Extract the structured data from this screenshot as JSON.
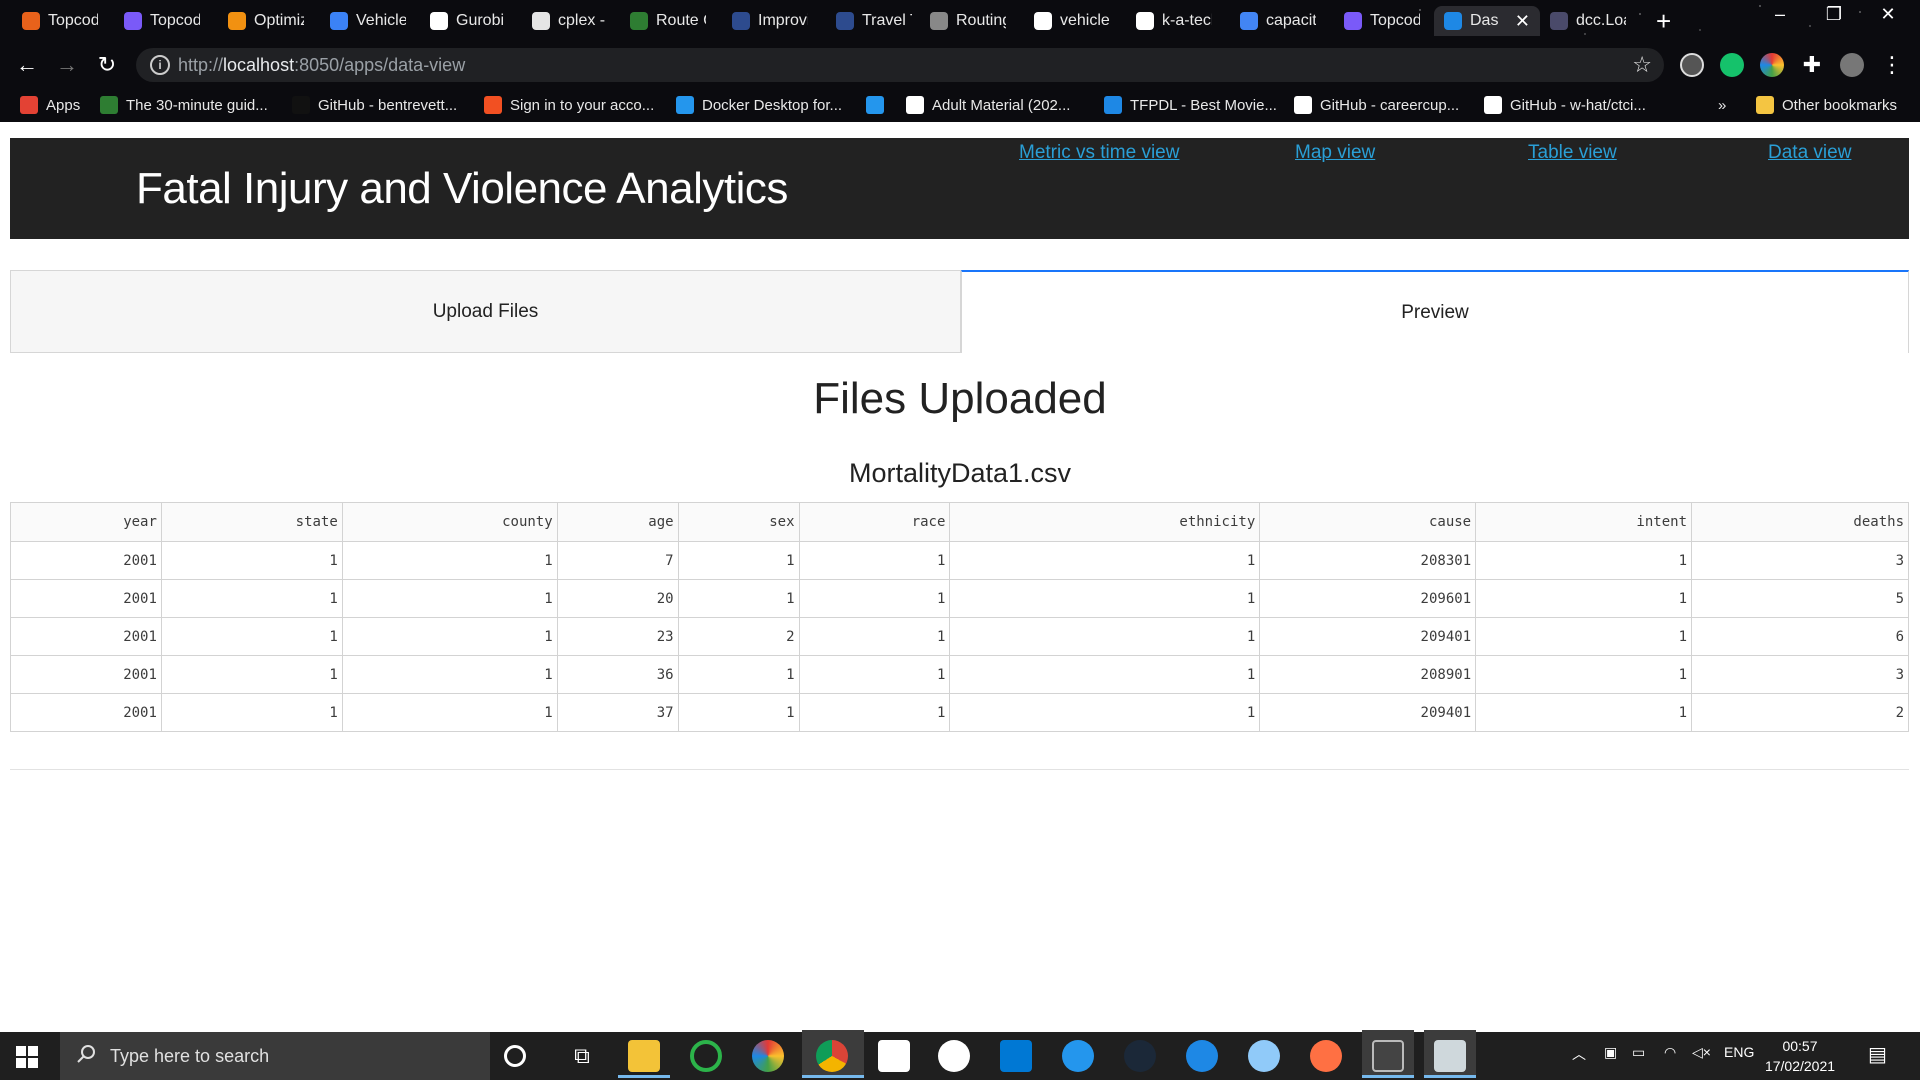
{
  "browser": {
    "tabs": [
      {
        "label": "Topcod",
        "color": "#e8621b"
      },
      {
        "label": "Topcod",
        "color": "#7a5af8"
      },
      {
        "label": "Optimiz",
        "color": "#f29111"
      },
      {
        "label": "Vehicle",
        "color": "#3b82f6"
      },
      {
        "label": "Gurobi",
        "color": "#ffffff"
      },
      {
        "label": "cplex - F",
        "color": "#e5e5e5"
      },
      {
        "label": "Route C",
        "color": "#2e7d32"
      },
      {
        "label": "Improvi",
        "color": "#2d4b8e"
      },
      {
        "label": "Travel T",
        "color": "#2d4b8e"
      },
      {
        "label": "Routing",
        "color": "#888888"
      },
      {
        "label": "vehicle",
        "color": "#ffffff"
      },
      {
        "label": "k-a-tecl",
        "color": "#ffffff"
      },
      {
        "label": "capacit",
        "color": "#4285f4"
      },
      {
        "label": "Topcod",
        "color": "#7a5af8"
      },
      {
        "label": "Das",
        "color": "#1e88e5"
      },
      {
        "label": "dcc.Loa",
        "color": "#4a4a6a"
      }
    ],
    "url_prefix": "http://",
    "url_host": "localhost",
    "url_rest": ":8050/apps/data-view",
    "bookmarks": [
      {
        "label": "Apps",
        "color": "#e34234"
      },
      {
        "label": "The 30-minute guid...",
        "color": "#2e7d32"
      },
      {
        "label": "GitHub - bentrevett...",
        "color": "#111111"
      },
      {
        "label": "Sign in to your acco...",
        "color": "#f25022"
      },
      {
        "label": "Docker Desktop for...",
        "color": "#2496ed"
      },
      {
        "label": "",
        "color": "#2496ed"
      },
      {
        "label": "Adult Material (202...",
        "color": "#ffffff"
      },
      {
        "label": "TFPDL - Best Movie...",
        "color": "#1e88e5"
      },
      {
        "label": "GitHub - careercup...",
        "color": "#ffffff"
      },
      {
        "label": "GitHub - w-hat/ctci...",
        "color": "#ffffff"
      }
    ],
    "bookmarks_overflow": "»",
    "other_bookmarks": "Other bookmarks"
  },
  "header": {
    "title": "Fatal Injury and Violence Analytics",
    "nav": [
      {
        "label": "Metric vs time view"
      },
      {
        "label": "Map view"
      },
      {
        "label": "Table view"
      },
      {
        "label": "Data view"
      }
    ]
  },
  "tabs": {
    "upload_label": "Upload Files",
    "preview_label": "Preview",
    "active": "Preview"
  },
  "content": {
    "title": "Files Uploaded",
    "file_name": "MortalityData1.csv",
    "table": {
      "columns": [
        "year",
        "state",
        "county",
        "age",
        "sex",
        "race",
        "ethnicity",
        "cause",
        "intent",
        "deaths"
      ],
      "rows": [
        [
          "2001",
          "1",
          "1",
          "7",
          "1",
          "1",
          "1",
          "208301",
          "1",
          "3"
        ],
        [
          "2001",
          "1",
          "1",
          "20",
          "1",
          "1",
          "1",
          "209601",
          "1",
          "5"
        ],
        [
          "2001",
          "1",
          "1",
          "23",
          "2",
          "1",
          "1",
          "209401",
          "1",
          "6"
        ],
        [
          "2001",
          "1",
          "1",
          "36",
          "1",
          "1",
          "1",
          "208901",
          "1",
          "3"
        ],
        [
          "2001",
          "1",
          "1",
          "37",
          "1",
          "1",
          "1",
          "209401",
          "1",
          "2"
        ]
      ]
    }
  },
  "taskbar": {
    "search_placeholder": "Type here to search",
    "language": "ENG",
    "time": "00:57",
    "date": "17/02/2021"
  },
  "colors": {
    "header_bg": "#222222",
    "link": "#2a9fd6",
    "active_tab_border": "#1975fa"
  }
}
